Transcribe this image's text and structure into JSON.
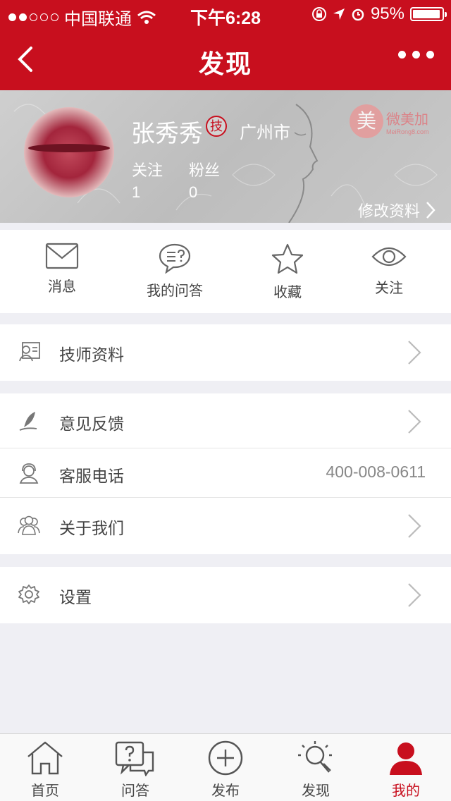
{
  "status_bar": {
    "carrier": "中国联通",
    "time": "下午6:28",
    "battery_percent": "95%",
    "battery_level": 0.95
  },
  "nav": {
    "title": "发现"
  },
  "profile": {
    "name": "张秀秀",
    "badge": "技",
    "city": "广州市",
    "follow_label": "关注",
    "follow_count": "1",
    "fans_label": "粉丝",
    "fans_count": "0",
    "edit_label": "修改资料",
    "logo_text": "微美加",
    "logo_mark": "美",
    "logo_sub": "MeiRong8.com"
  },
  "quick_actions": [
    {
      "label": "消息",
      "icon": "envelope-icon"
    },
    {
      "label": "我的问答",
      "icon": "chat-bubble-icon"
    },
    {
      "label": "收藏",
      "icon": "star-icon"
    },
    {
      "label": "关注",
      "icon": "eye-icon"
    }
  ],
  "menu": {
    "group1": [
      {
        "label": "技师资料",
        "icon": "id-card-icon"
      }
    ],
    "group2": [
      {
        "label": "意见反馈",
        "icon": "quill-icon"
      },
      {
        "label": "客服电话",
        "icon": "headset-icon",
        "value": "400-008-0611"
      },
      {
        "label": "关于我们",
        "icon": "people-icon"
      }
    ],
    "group3": [
      {
        "label": "设置",
        "icon": "gear-icon"
      }
    ]
  },
  "tabbar": {
    "tabs": [
      {
        "label": "首页",
        "icon": "home-icon"
      },
      {
        "label": "问答",
        "icon": "qa-icon"
      },
      {
        "label": "发布",
        "icon": "plus-circle-icon"
      },
      {
        "label": "发现",
        "icon": "lightbulb-icon"
      },
      {
        "label": "我的",
        "icon": "person-icon"
      }
    ],
    "active": "我的"
  },
  "colors": {
    "brand_red": "#c80f1e",
    "background": "#efeff4"
  }
}
